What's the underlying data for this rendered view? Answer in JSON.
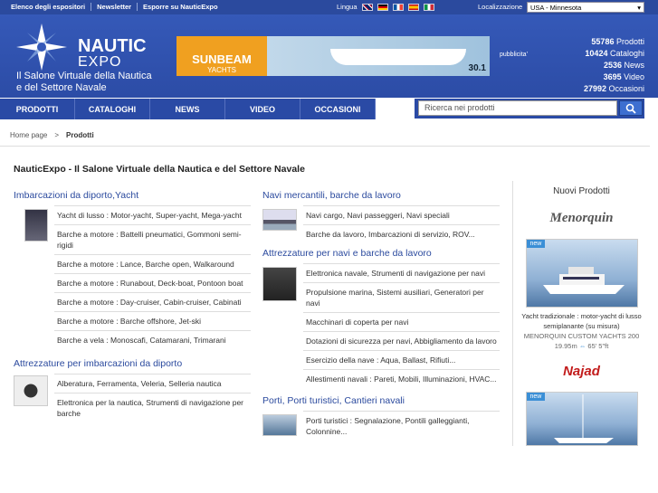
{
  "topbar": {
    "links": [
      "Elenco degli espositori",
      "Newsletter",
      "Esporre su NauticExpo"
    ],
    "lingua_label": "Lingua",
    "localizzazione_label": "Localizzazione",
    "location_value": "USA - Minnesota"
  },
  "header": {
    "logo_line1": "NAUTIC",
    "logo_line2": "EXPO",
    "tagline_line1": "Il Salone Virtuale della Nautica",
    "tagline_line2": "e del Settore Navale",
    "banner": {
      "brand": "SUNBEAM",
      "sub": "YACHTS",
      "model": "30.1"
    },
    "pubblicita": "pubblicita'",
    "stats": [
      {
        "num": "55786",
        "label": "Prodotti"
      },
      {
        "num": "10424",
        "label": "Cataloghi"
      },
      {
        "num": "2536",
        "label": "News"
      },
      {
        "num": "3695",
        "label": "Video"
      },
      {
        "num": "27992",
        "label": "Occasioni"
      }
    ]
  },
  "nav": [
    "PRODOTTI",
    "CATALOGHI",
    "NEWS",
    "VIDEO",
    "OCCASIONI"
  ],
  "search": {
    "placeholder": "Ricerca nei prodotti"
  },
  "breadcrumb": {
    "home": "Home page",
    "sep": ">",
    "current": "Prodotti"
  },
  "page_title": "NauticExpo - Il Salone Virtuale della Nautica e del Settore Navale",
  "left": [
    {
      "title": "Imbarcazioni da diporto,Yacht",
      "items": [
        "Yacht di lusso : Motor-yacht, Super-yacht, Mega-yacht",
        "Barche a motore : Battelli pneumatici, Gommoni semi-rigidi",
        "Barche a motore : Lance, Barche open, Walkaround",
        "Barche a motore : Runabout, Deck-boat, Pontoon boat",
        "Barche a motore : Day-cruiser, Cabin-cruiser, Cabinati",
        "Barche a motore : Barche offshore, Jet-ski",
        "Barche a vela : Monoscafi, Catamarani, Trimarani"
      ]
    },
    {
      "title": "Attrezzature per imbarcazioni da diporto",
      "items": [
        "Alberatura, Ferramenta, Veleria, Selleria nautica",
        "Elettronica per la nautica, Strumenti di navigazione per barche"
      ]
    }
  ],
  "middle": [
    {
      "title": "Navi mercantili, barche da lavoro",
      "items": [
        "Navi cargo, Navi passeggeri, Navi speciali",
        "Barche da lavoro, Imbarcazioni di servizio, ROV..."
      ]
    },
    {
      "title": "Attrezzature per navi e barche da lavoro",
      "items": [
        "Elettronica navale, Strumenti di navigazione per navi",
        "Propulsione marina, Sistemi ausiliari, Generatori per navi",
        "Macchinari di coperta per navi",
        "Dotazioni di sicurezza per navi, Abbigliamento da lavoro",
        "Esercizio della nave : Aqua, Ballast, Rifiuti...",
        "Allestimenti navali : Pareti, Mobili, Illuminazioni, HVAC..."
      ]
    },
    {
      "title": "Porti, Porti turistici, Cantieri navali",
      "items": [
        "Porti turistici : Segnalazione, Pontili galleggianti, Colonnine..."
      ]
    }
  ],
  "right": {
    "title": "Nuovi Prodotti",
    "brand1": "Menorquin",
    "new_tag": "new",
    "product1": {
      "desc": "Yacht tradizionale : motor-yacht di lusso semiplanante (su misura)",
      "name": "MENORQUIN CUSTOM YACHTS 200",
      "size": "19.95m",
      "size_ft": "65' 5\"ft"
    },
    "brand2": "Najad"
  }
}
